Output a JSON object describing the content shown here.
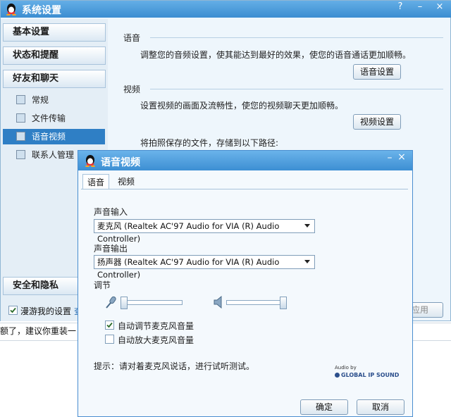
{
  "main": {
    "title": "系统设置",
    "help_icon": "?",
    "min_icon": "–",
    "close_icon": "×",
    "sidebar": {
      "basic": "基本设置",
      "status": "状态和提醒",
      "friends": "好友和聊天",
      "items": [
        {
          "label": "常规"
        },
        {
          "label": "文件传输"
        },
        {
          "label": "语音视频"
        },
        {
          "label": "联系人管理"
        }
      ],
      "security": "安全和隐私"
    },
    "roam_label": "漫游我的设置",
    "roam_trail": "查",
    "apply_label": "应用",
    "content": {
      "voice_title": "语音",
      "voice_desc": "调整您的音频设置，使其能达到最好的效果，使您的语音通话更加顺畅。",
      "voice_button": "语音设置",
      "video_title": "视频",
      "video_desc": "设置视频的画面及流畅性，使您的视频聊天更加顺畅。",
      "video_button": "视频设置",
      "path_text": "将拍照保存的文件，存储到以下路径:"
    }
  },
  "background_text": "额了，建议你重装一",
  "dialog": {
    "title": "语音视频",
    "close_icon": "×",
    "tabs": [
      {
        "label": "语音"
      },
      {
        "label": "视频"
      }
    ],
    "input_label": "声音输入",
    "input_value": "麦克风 (Realtek AC'97 Audio for VIA (R) Audio Controller)",
    "output_label": "声音输出",
    "output_value": "扬声器 (Realtek AC'97 Audio for VIA (R) Audio Controller)",
    "adjust_label": "调节",
    "mic_level": 0.0,
    "speaker_level": 1.0,
    "auto_adjust": {
      "label": "自动调节麦克风音量",
      "checked": true
    },
    "auto_amplify": {
      "label": "自动放大麦克风音量",
      "checked": false
    },
    "tip": "提示：请对着麦克风说话，进行试听测试。",
    "logo_top": "Audio by",
    "logo_bottom": "GLOBAL IP SOUND",
    "ok_label": "确定",
    "cancel_label": "取消"
  }
}
